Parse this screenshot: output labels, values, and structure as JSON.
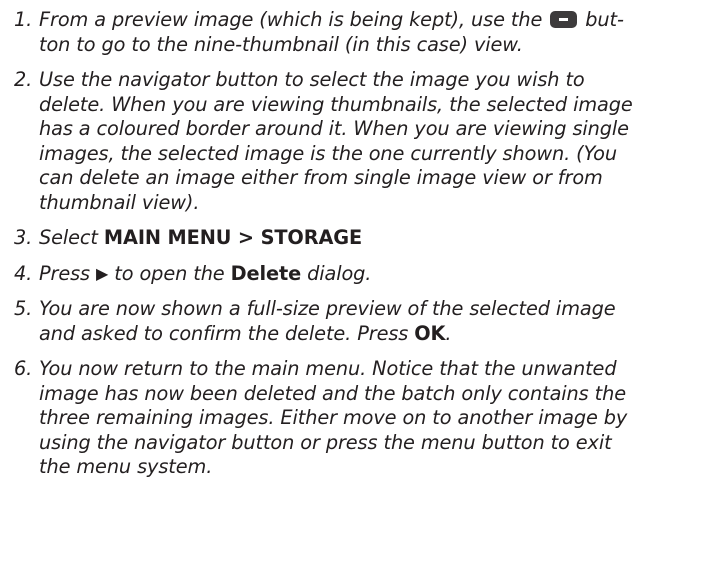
{
  "steps": [
    {
      "num": "1.",
      "line1_pre": "From a preview image (which is being kept), use the",
      "line1_post": " but-",
      "line2": "ton to go to the nine-thumbnail (in this case) view.",
      "icon": "menu-button-icon"
    },
    {
      "num": "2.",
      "lines": [
        "Use the navigator button to select the image you wish to",
        "delete. When you are viewing thumbnails, the selected image",
        "has a coloured border around it. When you are viewing single",
        "images, the selected image is the one currently shown. (You",
        "can delete an image either from single image view or from",
        "thumbnail view)."
      ]
    },
    {
      "num": "3.",
      "pre": "Select ",
      "bold1": "MAIN MENU",
      "sep": " > ",
      "bold2": "STORAGE"
    },
    {
      "num": "4.",
      "pre": "Press ",
      "arrow": "▶",
      "mid": " to open the ",
      "bold": "Delete",
      "post": " dialog."
    },
    {
      "num": "5.",
      "line1": "You are now shown a full-size preview of the selected image",
      "line2_pre": "and asked to confirm the delete. Press ",
      "line2_bold": "OK",
      "line2_post": "."
    },
    {
      "num": "6.",
      "lines": [
        "You now return to the main menu. Notice that the unwanted",
        "image has now been deleted and the batch only contains the",
        "three remaining images. Either move on to another image by",
        "using the navigator button or press the menu button to exit",
        "the menu system."
      ]
    }
  ]
}
